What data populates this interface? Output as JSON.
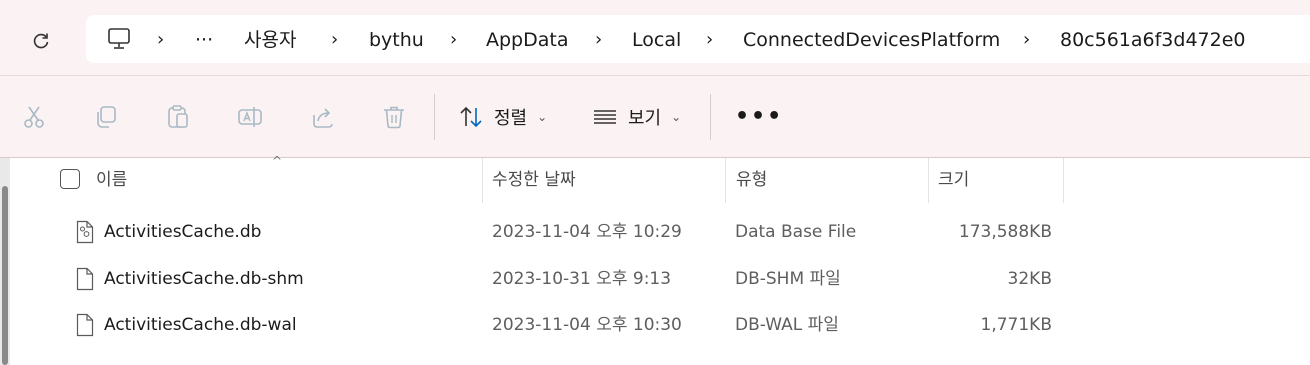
{
  "breadcrumb": {
    "items": [
      "사용자",
      "bythu",
      "AppData",
      "Local",
      "ConnectedDevicesPlatform",
      "80c561a6f3d472e0"
    ],
    "overflow": "···",
    "chevron": "›"
  },
  "toolbar": {
    "sort_label": "정렬",
    "view_label": "보기",
    "more_label": "•••",
    "dropdown_glyph": "⌄"
  },
  "columns": {
    "name": "이름",
    "modified": "수정한 날짜",
    "type": "유형",
    "size": "크기",
    "sort_indicator": "^"
  },
  "files": [
    {
      "name": "ActivitiesCache.db",
      "modified": "2023-11-04 오후 10:29",
      "type": "Data Base File",
      "size": "173,588KB",
      "icon": "database-file-icon"
    },
    {
      "name": "ActivitiesCache.db-shm",
      "modified": "2023-10-31 오후 9:13",
      "type": "DB-SHM 파일",
      "size": "32KB",
      "icon": "file-icon"
    },
    {
      "name": "ActivitiesCache.db-wal",
      "modified": "2023-11-04 오후 10:30",
      "type": "DB-WAL 파일",
      "size": "1,771KB",
      "icon": "file-icon"
    }
  ],
  "colors": {
    "chrome_bg": "#fbf3f3",
    "disabled_icon": "#a9b9c4",
    "accent": "#0067c0"
  }
}
